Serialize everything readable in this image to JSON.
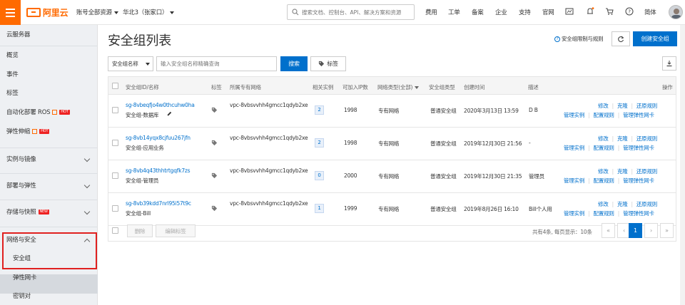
{
  "topbar": {
    "logo_text": "阿里云",
    "account_scope": "账号全部资源",
    "region": "华北3（张家口）",
    "search_placeholder": "搜索文档、控制台、API、解决方案和资源",
    "nav": [
      "费用",
      "工单",
      "备案",
      "企业",
      "支持",
      "官网"
    ],
    "language": "简体",
    "icons": [
      "screen-icon",
      "bell-icon",
      "cart-icon",
      "help-icon"
    ],
    "accent": "#ff6a00"
  },
  "sidebar": {
    "title": "云服务器",
    "items": [
      {
        "label": "概览"
      },
      {
        "label": "事件"
      },
      {
        "label": "标签"
      },
      {
        "label": "自动化部署 ROS",
        "badge": "HOT"
      },
      {
        "label": "弹性伸缩",
        "badge": "HOT"
      }
    ],
    "groups": [
      {
        "label": "实例与镜像"
      },
      {
        "label": "部署与弹性"
      },
      {
        "label": "存储与快照",
        "badge": "NEW"
      },
      {
        "label": "网络与安全"
      }
    ],
    "sub_items": [
      {
        "label": "安全组"
      },
      {
        "label": "弹性网卡"
      },
      {
        "label": "密钥对"
      }
    ]
  },
  "main": {
    "title": "安全组列表",
    "limit_link": "安全组限制与规则",
    "create_label": "创建安全组",
    "filter_select": "安全组名称",
    "filter_placeholder": "输入安全组名称精确查询",
    "search_label": "搜索",
    "tag_label": "标签",
    "primary_color": "#0070cc"
  },
  "table": {
    "headers": {
      "id_name": "安全组ID/名称",
      "tag": "标签",
      "vpc": "所属专有网络",
      "related": "相关实例",
      "ip": "可加入IP数",
      "net_type": "网络类型(全部)",
      "sg_type": "安全组类型",
      "created": "创建时间",
      "desc": "描述",
      "ops": "操作"
    },
    "rows": [
      {
        "id": "sg-8vbeqfjo4w0thcuhw0ha",
        "name": "安全组-数据库",
        "vpc": "vpc-8vbsvvhh4gmcc1qdyb2xe",
        "related": "2",
        "ip": "1998",
        "net_type": "专有网络",
        "sg_type": "普通安全组",
        "created": "2020年3月13日 13:59",
        "desc": "D B"
      },
      {
        "id": "sg-8vb14yqx8cjfuu267jfn",
        "name": "安全组-应用业务",
        "vpc": "vpc-8vbsvvhh4gmcc1qdyb2xe",
        "related": "2",
        "ip": "1998",
        "net_type": "专有网络",
        "sg_type": "普通安全组",
        "created": "2019年12月30日 21:56",
        "desc": "-"
      },
      {
        "id": "sg-8vb4q43thhtrtgqfk7zs",
        "name": "安全组-管理员",
        "vpc": "vpc-8vbsvvhh4gmcc1qdyb2xe",
        "related": "0",
        "ip": "2000",
        "net_type": "专有网络",
        "sg_type": "普通安全组",
        "created": "2019年12月30日 21:35",
        "desc": "管理员"
      },
      {
        "id": "sg-8vb39kdd7nrl95i57t9c",
        "name": "安全组-Bill",
        "vpc": "vpc-8vbsvvhh4gmcc1qdyb2xe",
        "related": "1",
        "ip": "1999",
        "net_type": "专有网络",
        "sg_type": "普通安全组",
        "created": "2019年8月26日 16:10",
        "desc": "Bill个人用"
      }
    ],
    "ops_line1": [
      "修改",
      "克隆",
      "还原规则"
    ],
    "ops_line2": [
      "管理实例",
      "配置规则",
      "管理弹性网卡"
    ],
    "footer": {
      "delete_label": "删除",
      "edit_tag_label": "编辑标签",
      "summary": "共有4条, 每页显示：10条",
      "pager": [
        "«",
        "‹",
        "1",
        "›",
        "»"
      ]
    }
  }
}
